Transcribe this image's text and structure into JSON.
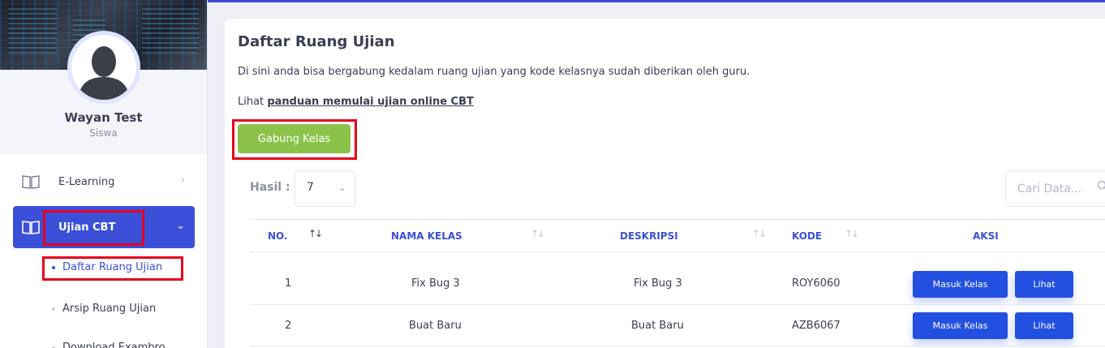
{
  "user": {
    "name": "Wayan Test",
    "role": "Siswa"
  },
  "sidebar": {
    "items": [
      {
        "label": "E-Learning",
        "icon": "book-icon"
      },
      {
        "label": "Ujian CBT",
        "icon": "book-icon"
      }
    ],
    "sub_items": [
      "Daftar Ruang Ujian",
      "Arsip Ruang Ujian",
      "Download Exambro"
    ]
  },
  "main": {
    "title": "Daftar Ruang Ujian",
    "description": "Di sini anda bisa bergabung kedalam ruang ujian yang kode kelasnya sudah diberikan oleh guru.",
    "guide_prefix": "Lihat",
    "guide_link": "panduan memulai ujian online CBT",
    "join_button": "Gabung Kelas",
    "hasil_label": "Hasil :",
    "hasil_value": "7",
    "search_placeholder": "Cari Data..."
  },
  "table": {
    "headers": [
      "NO.",
      "NAMA KELAS",
      "DESKRIPSI",
      "KODE",
      "AKSI"
    ],
    "rows": [
      {
        "no": "1",
        "nama": "Fix Bug 3",
        "deskripsi": "Fix Bug 3",
        "kode": "ROY6060",
        "masuk": "Masuk Kelas",
        "lihat": "Lihat"
      },
      {
        "no": "2",
        "nama": "Buat Baru",
        "deskripsi": "Buat Baru",
        "kode": "AZB6067",
        "masuk": "Masuk Kelas",
        "lihat": "Lihat"
      }
    ]
  },
  "colors": {
    "primary": "#3b4fd8",
    "button_blue": "#2350e0",
    "join_green": "#8bc34a",
    "highlight_red": "#e8001c"
  }
}
